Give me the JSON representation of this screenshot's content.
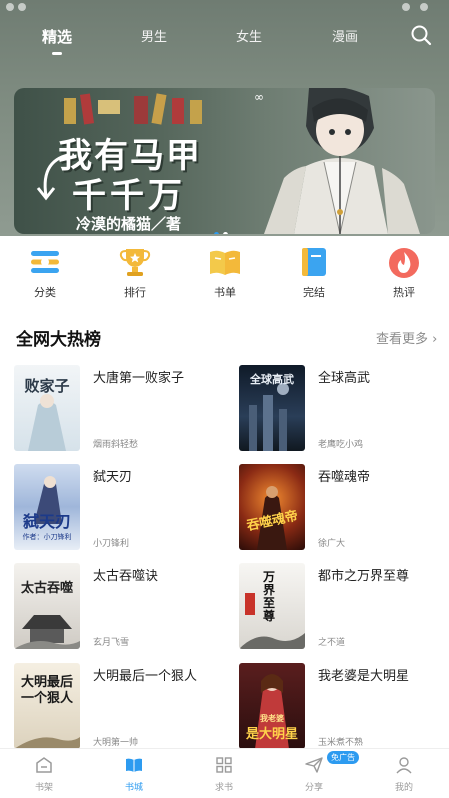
{
  "top_tabs": [
    {
      "label": "精选",
      "active": true
    },
    {
      "label": "男生",
      "active": false
    },
    {
      "label": "女生",
      "active": false
    },
    {
      "label": "漫画",
      "active": false
    }
  ],
  "banner": {
    "title_line1": "我有马甲",
    "title_line2": "千千万",
    "author": "冷漠的橘猫／著",
    "logo_mark": "∞",
    "slides": 2,
    "active_slide": 0
  },
  "categories": [
    {
      "label": "分类",
      "icon": "category-icon"
    },
    {
      "label": "排行",
      "icon": "trophy-icon"
    },
    {
      "label": "书单",
      "icon": "book-list-icon"
    },
    {
      "label": "完结",
      "icon": "finished-book-icon"
    },
    {
      "label": "热评",
      "icon": "flame-icon"
    }
  ],
  "section": {
    "title": "全网大热榜",
    "more": "查看更多"
  },
  "books": [
    {
      "title": "大唐第一败家子",
      "author": "烟雨斜轻愁",
      "cover_text": "败家子",
      "cover_color": "#e9eef2"
    },
    {
      "title": "全球高武",
      "author": "老鹰吃小鸡",
      "cover_text": "全球高武",
      "cover_color": "#1d2a3a"
    },
    {
      "title": "弑天刃",
      "author": "小刀锋利",
      "cover_text": "弑天刃",
      "cover_color": "#dfe6f2",
      "cover_sub": "作者：小刀锋利"
    },
    {
      "title": "吞噬魂帝",
      "author": "徐广大",
      "cover_text": "吞噬魂帝",
      "cover_color": "#5a1e10"
    },
    {
      "title": "太古吞噬诀",
      "author": "玄月飞雪",
      "cover_text": "太古吞噬",
      "cover_color": "#eceae6"
    },
    {
      "title": "都市之万界至尊",
      "author": "之不道",
      "cover_text": "万界至尊",
      "cover_color": "#f2f0ec"
    },
    {
      "title": "大明最后一个狠人",
      "author": "大明第一帅",
      "cover_text": "大明最后一个狠人",
      "cover_color": "#efe9dc"
    },
    {
      "title": "我老婆是大明星",
      "author": "玉米煮不熟",
      "cover_text": "是大明星",
      "cover_color": "#3a1a1a",
      "cover_sub": "我老婆"
    }
  ],
  "bottom_nav": [
    {
      "label": "书架",
      "icon": "bookshelf-icon",
      "active": false
    },
    {
      "label": "书城",
      "icon": "open-book-icon",
      "active": true
    },
    {
      "label": "求书",
      "icon": "grid-icon",
      "active": false
    },
    {
      "label": "分享",
      "icon": "send-icon",
      "active": false,
      "badge": "免广告"
    },
    {
      "label": "我的",
      "icon": "profile-icon",
      "active": false
    }
  ],
  "colors": {
    "accent": "#2d9bf0",
    "hero": "#7e8b80"
  }
}
